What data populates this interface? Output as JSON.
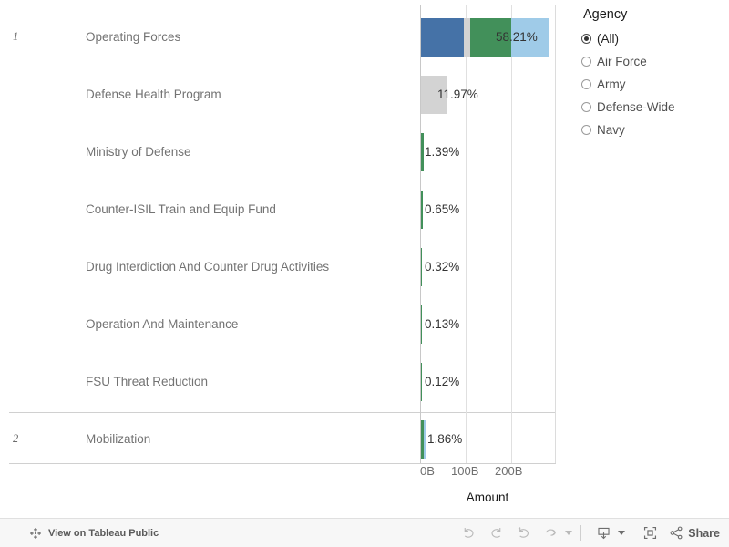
{
  "chart_data": {
    "type": "bar",
    "subtype": "stacked-horizontal",
    "title": "",
    "xlabel": "Amount",
    "ylabel": "",
    "xlim": [
      0,
      296
    ],
    "x_tick_labels": [
      "0B",
      "100B",
      "200B"
    ],
    "x_tick_values": [
      0,
      100,
      200
    ],
    "grid": true,
    "value_unit": "percent-of-total",
    "series": [
      {
        "name": "Air Force",
        "color": "#4572a7"
      },
      {
        "name": "Army",
        "color": "#d3d3d3"
      },
      {
        "name": "Defense-Wide",
        "color": "#42905a"
      },
      {
        "name": "Navy",
        "color": "#9fcbe8"
      }
    ],
    "groups": [
      {
        "index": "1",
        "rows": [
          {
            "category": "Operating Forces",
            "label": "58.21%",
            "total_pct": 58.21,
            "segments": [
              {
                "series": "Air Force",
                "color": "#4572a7",
                "width_pct": 19.2
              },
              {
                "series": "Army",
                "color": "#d3d3d3",
                "width_pct": 4.7
              },
              {
                "series": "Defense-Wide",
                "color": "#42905a",
                "width_pct": 30.4
              },
              {
                "series": "Navy",
                "color": "#9fcbe8",
                "width_pct": 29.0
              }
            ]
          },
          {
            "category": "Defense Health Program",
            "label": "11.97%",
            "total_pct": 11.97,
            "segments": [
              {
                "series": "Army",
                "color": "#d3d3d3",
                "width_pct": 19.0
              }
            ]
          },
          {
            "category": "Ministry of Defense",
            "label": "1.39%",
            "total_pct": 1.39,
            "segments": [
              {
                "series": "Defense-Wide",
                "color": "#42905a",
                "width_pct": 2.3
              }
            ]
          },
          {
            "category": "Counter-ISIL Train and Equip Fund",
            "label": "0.65%",
            "total_pct": 0.65,
            "segments": [
              {
                "series": "Defense-Wide",
                "color": "#42905a",
                "width_pct": 1.7
              }
            ]
          },
          {
            "category": "Drug Interdiction And Counter Drug Activities",
            "label": "0.32%",
            "total_pct": 0.32,
            "segments": [
              {
                "series": "Defense-Wide",
                "color": "#42905a",
                "width_pct": 0.7
              }
            ]
          },
          {
            "category": "Operation And Maintenance",
            "label": "0.13%",
            "total_pct": 0.13,
            "segments": [
              {
                "series": "Defense-Wide",
                "color": "#42905a",
                "width_pct": 0.5
              }
            ]
          },
          {
            "category": "FSU Threat Reduction",
            "label": "0.12%",
            "total_pct": 0.12,
            "segments": [
              {
                "series": "Defense-Wide",
                "color": "#42905a",
                "width_pct": 0.5
              }
            ]
          }
        ]
      },
      {
        "index": "2",
        "rows": [
          {
            "category": "Mobilization",
            "label": "1.86%",
            "total_pct": 1.86,
            "segments": [
              {
                "series": "Defense-Wide",
                "color": "#42905a",
                "width_pct": 1.4
              },
              {
                "series": "Navy",
                "color": "#9fcbe8",
                "width_pct": 1.8
              }
            ]
          }
        ]
      }
    ]
  },
  "chart": {
    "axis_title": "Amount",
    "ticks": [
      {
        "label": "0B"
      },
      {
        "label": "100B"
      },
      {
        "label": "200B"
      }
    ],
    "rows": [
      {
        "index": "1",
        "category": "Operating Forces",
        "value_label": "58.21%"
      },
      {
        "index": "",
        "category": "Defense Health Program",
        "value_label": "11.97%"
      },
      {
        "index": "",
        "category": "Ministry of Defense",
        "value_label": "1.39%"
      },
      {
        "index": "",
        "category": "Counter-ISIL Train and Equip Fund",
        "value_label": "0.65%"
      },
      {
        "index": "",
        "category": "Drug Interdiction And Counter Drug Activities",
        "value_label": "0.32%"
      },
      {
        "index": "",
        "category": "Operation And Maintenance",
        "value_label": "0.13%"
      },
      {
        "index": "",
        "category": "FSU Threat Reduction",
        "value_label": "0.12%"
      },
      {
        "index": "2",
        "category": "Mobilization",
        "value_label": "1.86%"
      }
    ]
  },
  "filter": {
    "title": "Agency",
    "options": [
      {
        "label": "(All)",
        "selected": true
      },
      {
        "label": "Air Force",
        "selected": false
      },
      {
        "label": "Army",
        "selected": false
      },
      {
        "label": "Defense-Wide",
        "selected": false
      },
      {
        "label": "Navy",
        "selected": false
      }
    ]
  },
  "toolbar": {
    "public_link": "View on Tableau Public",
    "share_label": "Share",
    "icons": {
      "logo": "tableau-logo-icon",
      "undo": "undo-icon",
      "redo": "redo-icon",
      "revert": "revert-icon",
      "refresh": "refresh-icon",
      "download": "download-icon",
      "fullscreen": "fullscreen-icon",
      "share": "share-icon"
    }
  },
  "colors": {
    "air_force": "#4572a7",
    "army": "#d3d3d3",
    "defense_wide": "#42905a",
    "navy": "#9fcbe8",
    "toolbar_bg": "#f7f7f7"
  }
}
